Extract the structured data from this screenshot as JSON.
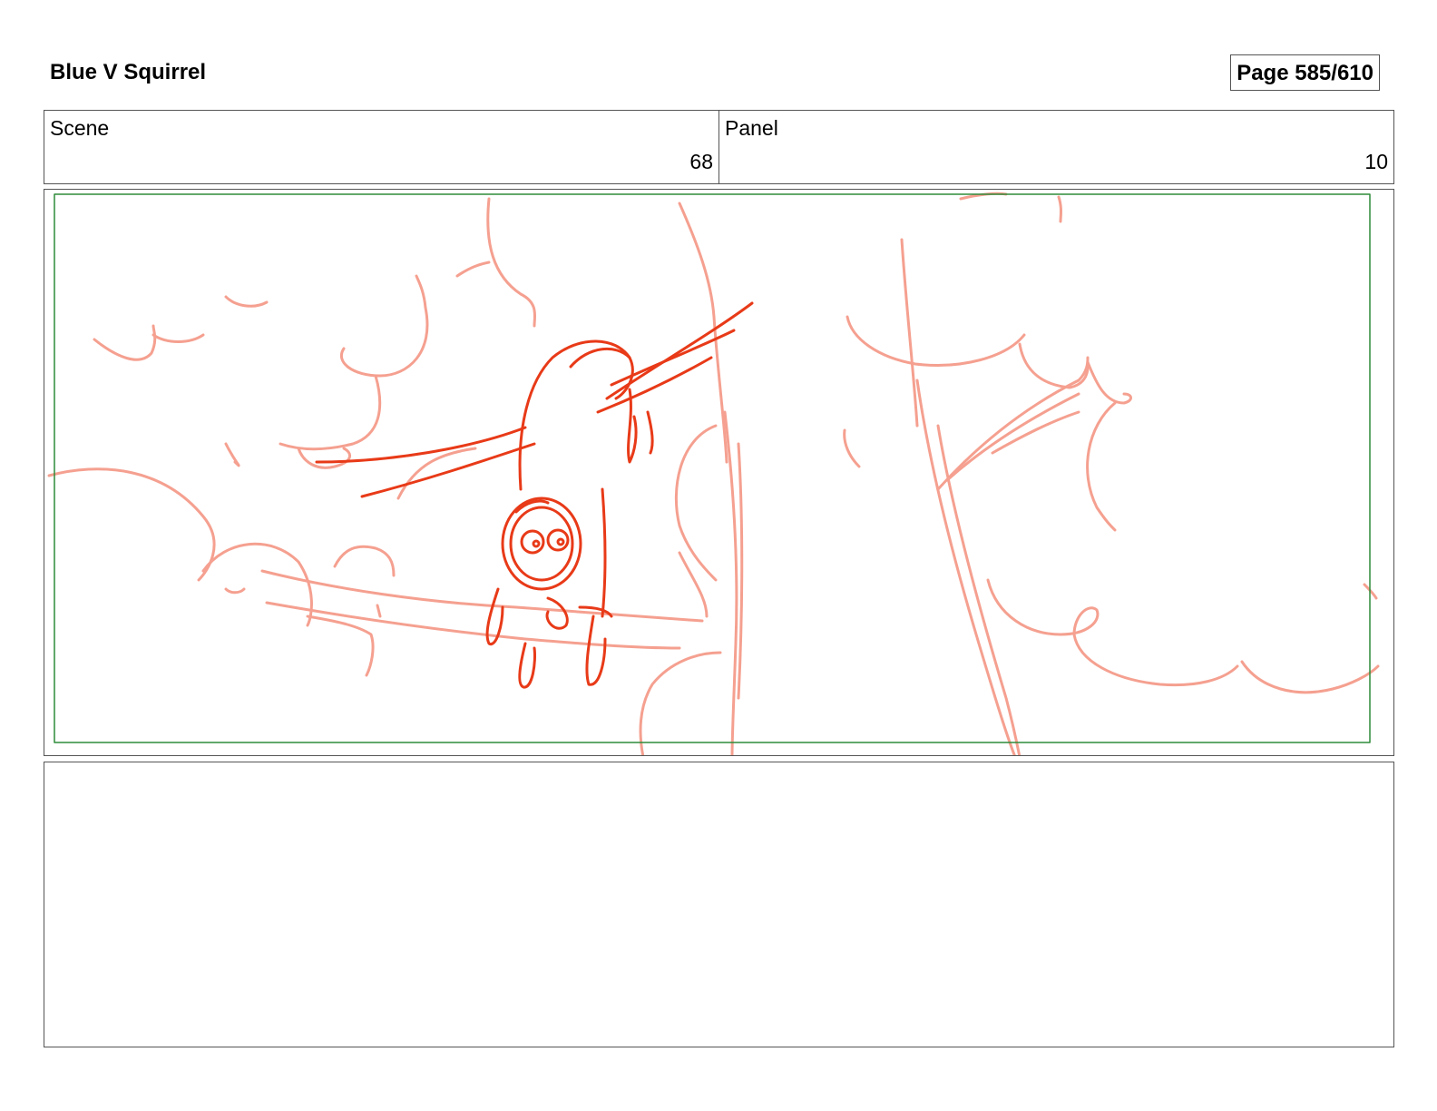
{
  "header": {
    "title": "Blue V Squirrel",
    "page_label": "Page 585/610"
  },
  "info": {
    "scene_label": "Scene",
    "scene_value": "68",
    "panel_label": "Panel",
    "panel_value": "10"
  },
  "panel": {
    "safe_frame_color": "#2e8b3a",
    "sketch_light_color": "#f5a090",
    "sketch_dark_color": "#e83a18"
  },
  "notes": {
    "text": ""
  }
}
